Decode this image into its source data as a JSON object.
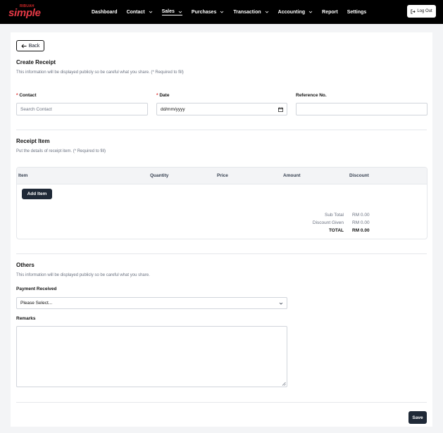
{
  "brand": {
    "small": "RIBUAH",
    "name": "simple"
  },
  "nav": [
    {
      "label": "Dashboard",
      "dropdown": false
    },
    {
      "label": "Contact",
      "dropdown": true
    },
    {
      "label": "Sales",
      "dropdown": true,
      "active": true
    },
    {
      "label": "Purchases",
      "dropdown": true
    },
    {
      "label": "Transaction",
      "dropdown": true
    },
    {
      "label": "Accounting",
      "dropdown": true
    },
    {
      "label": "Report",
      "dropdown": false
    },
    {
      "label": "Settings",
      "dropdown": false
    }
  ],
  "logout_label": "Log Out",
  "back_label": "Back",
  "create": {
    "title": "Create Receipt",
    "subtitle": "This information will be displayed publicly so be careful what you share. (* Required to fill)",
    "contact_label": "Contact",
    "contact_placeholder": "Search Contact",
    "date_label": "Date",
    "date_value": "dd/mm/yyyy",
    "reference_label": "Reference No.",
    "reference_value": ""
  },
  "items": {
    "title": "Receipt Item",
    "subtitle": "Put the details of receipt item. (* Required to fill)",
    "columns": [
      "Item",
      "Quantity",
      "Price",
      "Amount",
      "Discount"
    ],
    "add_label": "Add Item",
    "totals": [
      {
        "label": "Sub Total",
        "value": "RM 0.00"
      },
      {
        "label": "Discount Given",
        "value": "RM 0.00"
      },
      {
        "label": "TOTAL",
        "value": "RM 0.00"
      }
    ]
  },
  "others": {
    "title": "Others",
    "subtitle": "This information will be displayed publicly so be careful what you share.",
    "payment_label": "Payment Received",
    "payment_selected": "Please Select...",
    "remarks_label": "Remarks"
  },
  "save_label": "Save",
  "colors": {
    "brand": "#e63946",
    "topbar": "#000000",
    "primary_button": "#1f2937",
    "required": "#dc2626"
  }
}
